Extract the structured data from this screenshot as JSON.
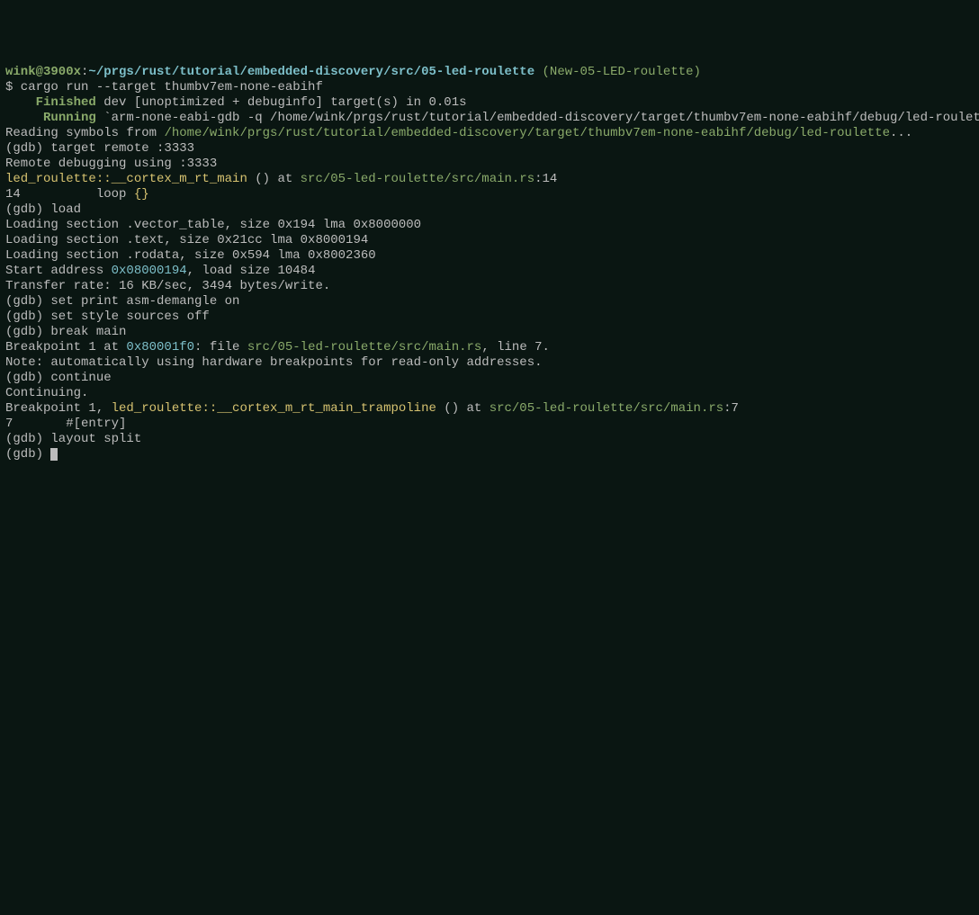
{
  "prompt": {
    "user_host": "wink@3900x",
    "colon": ":",
    "cwd": "~/prgs/rust/tutorial/embedded-discovery/src/05-led-roulette",
    "branch": " (New-05-LED-roulette)"
  },
  "lines": {
    "l01": "$ cargo run --target thumbv7em-none-eabihf",
    "l02a": "    ",
    "l02b": "Finished",
    "l02c": " dev [unoptimized + debuginfo] target(s) in 0.01s",
    "l03a": "     ",
    "l03b": "Running",
    "l03c": " `arm-none-eabi-gdb -q /home/wink/prgs/rust/tutorial/embedded-discovery/target/thumbv7em-none-eabihf/debug/led-roulette`",
    "l04a": "Reading symbols from ",
    "l04b": "/home/wink/prgs/rust/tutorial/embedded-discovery/target/thumbv7em-none-eabihf/debug/led-roulette",
    "l04c": "...",
    "l05": "(gdb) target remote :3333",
    "l06": "Remote debugging using :3333",
    "l07a": "led_roulette::__cortex_m_rt_main",
    "l07b": " () at ",
    "l07c": "src/05-led-roulette/src/main.rs",
    "l07d": ":14",
    "l08a": "14          loop ",
    "l08b": "{}",
    "l09": "(gdb) load",
    "l10": "Loading section .vector_table, size 0x194 lma 0x8000000",
    "l11": "Loading section .text, size 0x21cc lma 0x8000194",
    "l12": "Loading section .rodata, size 0x594 lma 0x8002360",
    "l13a": "Start address ",
    "l13b": "0x08000194",
    "l13c": ", load size 10484",
    "l14": "Transfer rate: 16 KB/sec, 3494 bytes/write.",
    "l15": "(gdb) set print asm-demangle on",
    "l16": "(gdb) set style sources off",
    "l17": "(gdb) break main",
    "l18a": "Breakpoint 1 at ",
    "l18b": "0x80001f0",
    "l18c": ": file ",
    "l18d": "src/05-led-roulette/src/main.rs",
    "l18e": ", line 7.",
    "l19": "Note: automatically using hardware breakpoints for read-only addresses.",
    "l20": "(gdb) continue",
    "l21": "Continuing.",
    "l22": "",
    "l23a": "Breakpoint 1, ",
    "l23b": "led_roulette::__cortex_m_rt_main_trampoline",
    "l23c": " () at ",
    "l23d": "src/05-led-roulette/src/main.rs",
    "l23e": ":7",
    "l24": "7       #[entry]",
    "l25": "(gdb) layout split",
    "l26": "(gdb) "
  }
}
